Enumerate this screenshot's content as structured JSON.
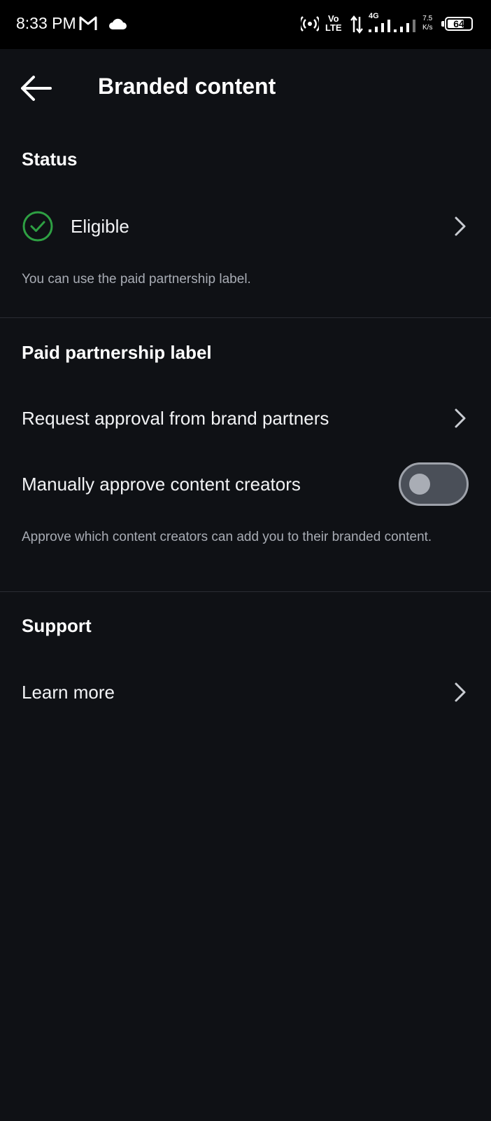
{
  "status_bar": {
    "time": "8:33 PM",
    "volte_top": "Vo",
    "volte_bottom": "LTE",
    "network": "4G",
    "speed_top": "7.5",
    "speed_bottom": "K/s",
    "battery": "64"
  },
  "header": {
    "title": "Branded content",
    "back_icon": "arrow-left-icon"
  },
  "status_section": {
    "title": "Status",
    "status_label": "Eligible",
    "status_icon": "check-circle-icon",
    "status_color": "#2ea043",
    "description": "You can use the paid partnership label."
  },
  "paid_partnership_section": {
    "title": "Paid partnership label",
    "request_approval_label": "Request approval from brand partners",
    "manual_approve_label": "Manually approve content creators",
    "manual_approve_enabled": false,
    "description": "Approve which content creators can add you to their branded content."
  },
  "support_section": {
    "title": "Support",
    "learn_more_label": "Learn more"
  }
}
